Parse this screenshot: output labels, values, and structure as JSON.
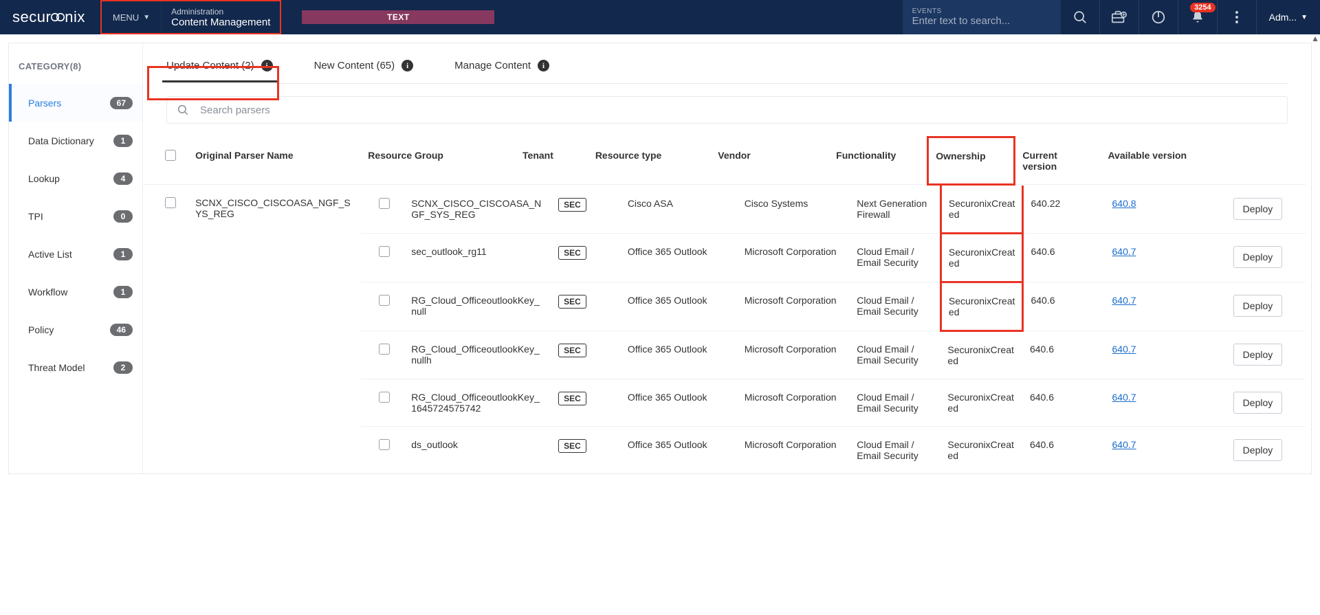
{
  "top": {
    "logo_prefix": "secur",
    "logo_suffix": "nix",
    "menu": "MENU",
    "crumb1": "Administration",
    "crumb2": "Content Management",
    "textbar": "TEXT",
    "events_label": "EVENTS",
    "events_ph": "Enter text to search...",
    "notif_count": "3254",
    "user": "Adm..."
  },
  "side": {
    "heading": "CATEGORY(8)",
    "items": [
      {
        "label": "Parsers",
        "count": "67",
        "active": true
      },
      {
        "label": "Data Dictionary",
        "count": "1"
      },
      {
        "label": "Lookup",
        "count": "4"
      },
      {
        "label": "TPI",
        "count": "0"
      },
      {
        "label": "Active List",
        "count": "1"
      },
      {
        "label": "Workflow",
        "count": "1"
      },
      {
        "label": "Policy",
        "count": "46"
      },
      {
        "label": "Threat Model",
        "count": "2"
      }
    ]
  },
  "tabs": {
    "t0": "Update Content (2)",
    "t1": "New Content (65)",
    "t2": "Manage Content"
  },
  "search_ph": "Search parsers",
  "cols": {
    "c1": "Original Parser Name",
    "c2": "Resource Group",
    "c3": "Tenant",
    "c4": "Resource type",
    "c5": "Vendor",
    "c6": "Functionality",
    "c7": "Ownership",
    "c8": "Current version",
    "c9": "Available version"
  },
  "tenant_chip": "SEC",
  "deploy": "Deploy",
  "group": {
    "orig": "SCNX_CISCO_CISCOASA_NGF_SYS_REG",
    "rows": [
      {
        "rg": "SCNX_CISCO_CISCOASA_NGF_SYS_REG",
        "rtype": "Cisco ASA",
        "vendor": "Cisco Systems",
        "func": "Next Generation Firewall",
        "own": "SecuronixCreated",
        "cur": "640.22",
        "av": "640.8"
      },
      {
        "rg": "sec_outlook_rg11",
        "rtype": "Office 365 Outlook",
        "vendor": "Microsoft Corporation",
        "func": "Cloud Email / Email Security",
        "own": "SecuronixCreated",
        "cur": "640.6",
        "av": "640.7"
      },
      {
        "rg": "RG_Cloud_OfficeoutlookKey_null",
        "rtype": "Office 365 Outlook",
        "vendor": "Microsoft Corporation",
        "func": "Cloud Email / Email Security",
        "own": "SecuronixCreated",
        "cur": "640.6",
        "av": "640.7"
      },
      {
        "rg": "RG_Cloud_OfficeoutlookKey_nullh",
        "rtype": "Office 365 Outlook",
        "vendor": "Microsoft Corporation",
        "func": "Cloud Email / Email Security",
        "own": "SecuronixCreated",
        "cur": "640.6",
        "av": "640.7"
      },
      {
        "rg": "RG_Cloud_OfficeoutlookKey_1645724575742",
        "rtype": "Office 365 Outlook",
        "vendor": "Microsoft Corporation",
        "func": "Cloud Email / Email Security",
        "own": "SecuronixCreated",
        "cur": "640.6",
        "av": "640.7"
      },
      {
        "rg": "ds_outlook",
        "rtype": "Office 365 Outlook",
        "vendor": "Microsoft Corporation",
        "func": "Cloud Email / Email Security",
        "own": "SecuronixCreated",
        "cur": "640.6",
        "av": "640.7"
      }
    ]
  }
}
